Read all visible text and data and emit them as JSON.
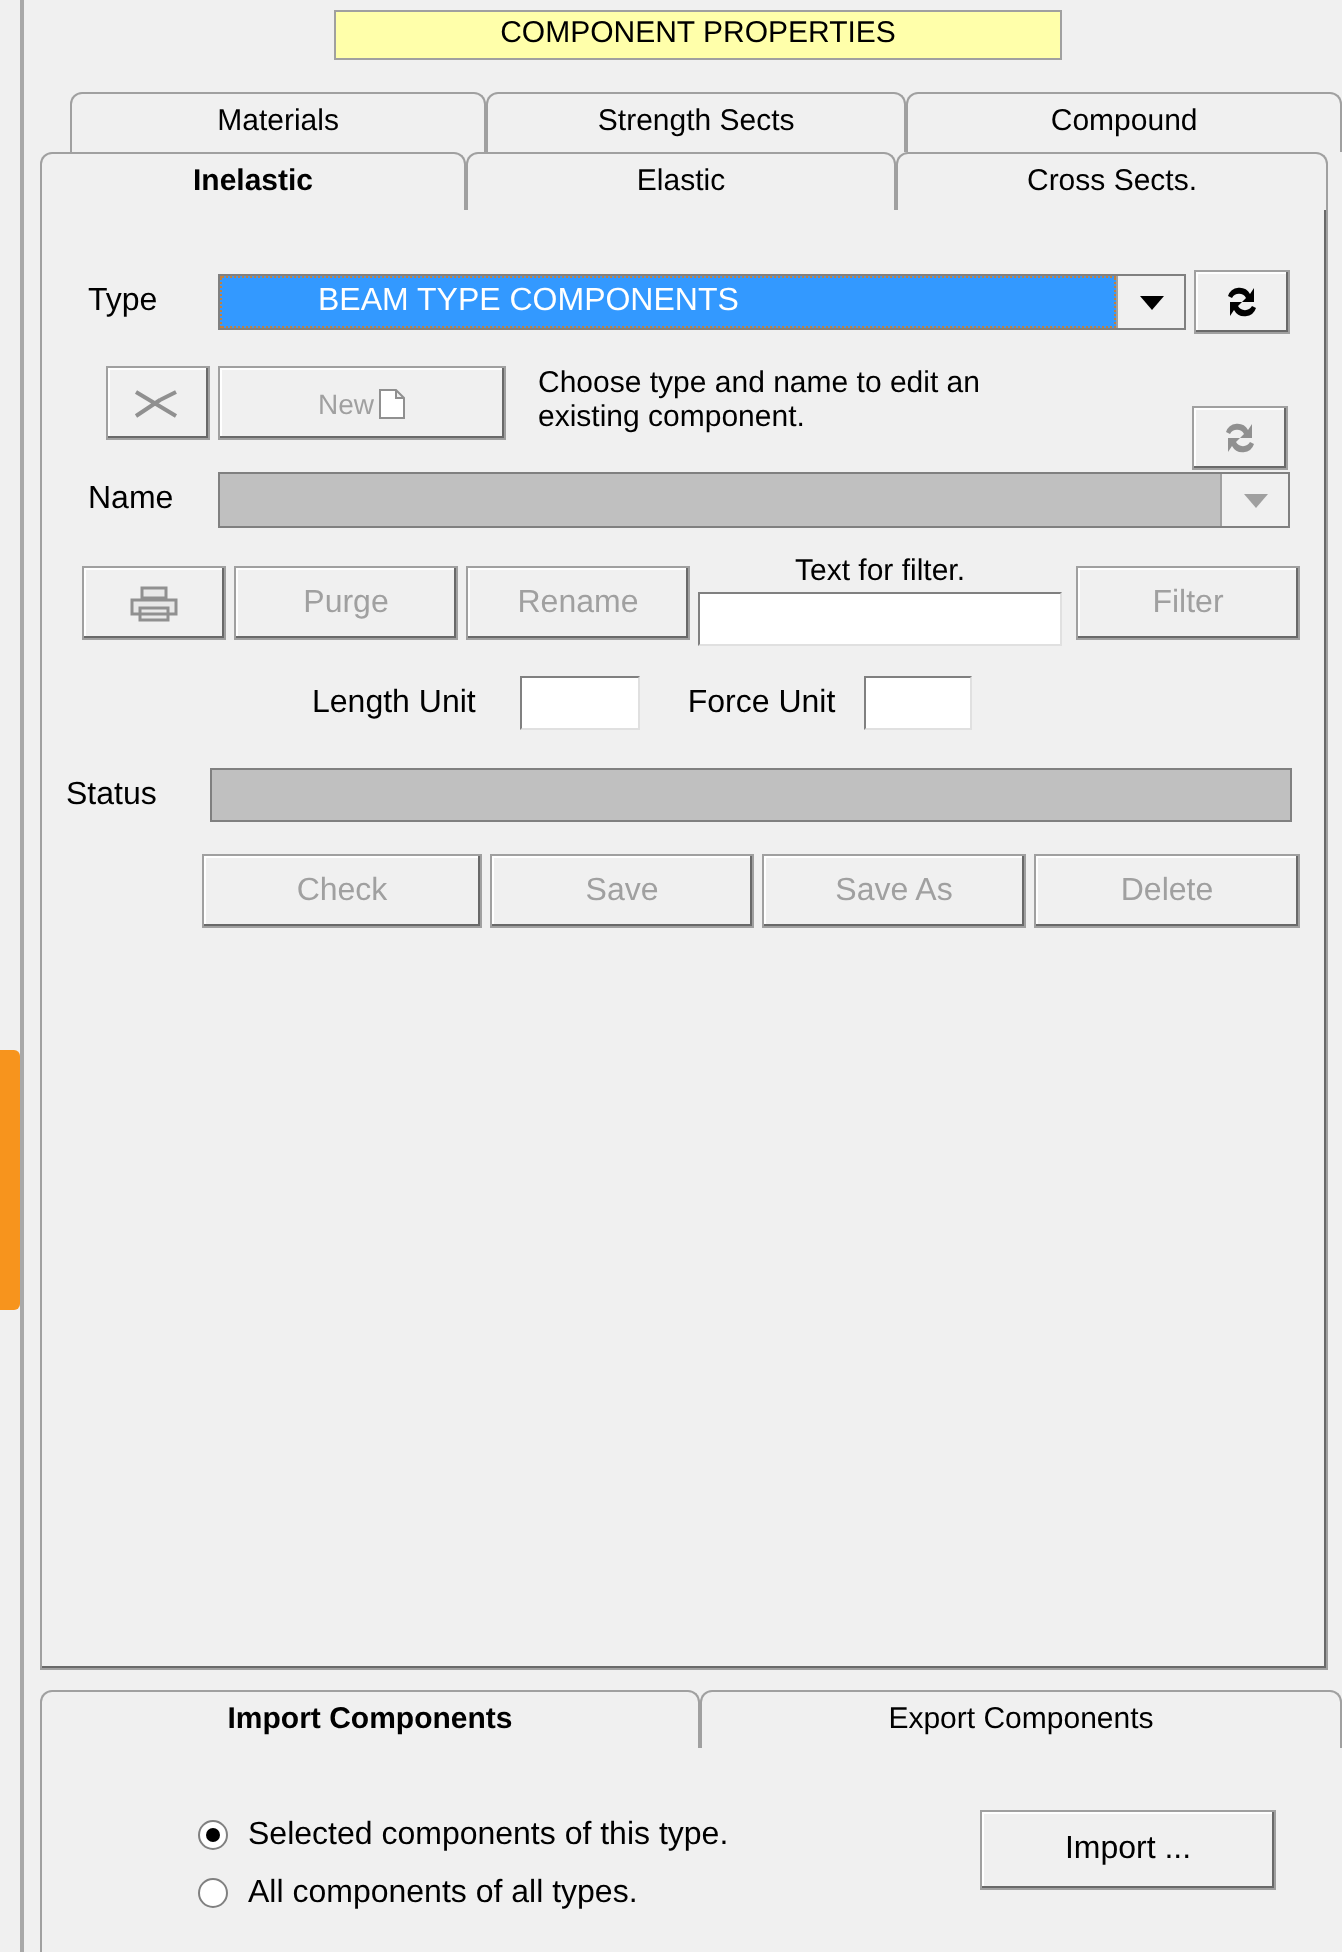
{
  "title": "COMPONENT PROPERTIES",
  "tabs_back": [
    {
      "label": "Materials",
      "selected": false
    },
    {
      "label": "Strength Sects",
      "selected": false
    },
    {
      "label": "Compound",
      "selected": false
    }
  ],
  "tabs_front": [
    {
      "label": "Inelastic",
      "selected": true
    },
    {
      "label": "Elastic",
      "selected": false
    },
    {
      "label": "Cross Sects.",
      "selected": false
    }
  ],
  "type": {
    "label": "Type",
    "value": "BEAM TYPE COMPONENTS"
  },
  "new_button": {
    "label": "New",
    "disabled": true
  },
  "hint": "Choose type and name to edit an existing component.",
  "name": {
    "label": "Name",
    "disabled": true
  },
  "manage_buttons": [
    {
      "label": "Purge",
      "disabled": true
    },
    {
      "label": "Rename",
      "disabled": true
    }
  ],
  "filter": {
    "label": "Text for filter.",
    "button": "Filter",
    "disabled": true
  },
  "units": {
    "length_label": "Length Unit",
    "force_label": "Force Unit"
  },
  "status": {
    "label": "Status"
  },
  "action_buttons": [
    {
      "label": "Check",
      "disabled": true
    },
    {
      "label": "Save",
      "disabled": true
    },
    {
      "label": "Save As",
      "disabled": true
    },
    {
      "label": "Delete",
      "disabled": true
    }
  ],
  "bottom_tabs": [
    {
      "label": "Import Components",
      "selected": true
    },
    {
      "label": "Export Components",
      "selected": false
    }
  ],
  "radios": [
    {
      "label": "Selected components of this type.",
      "selected": true
    },
    {
      "label": "All components of all types.",
      "selected": false
    }
  ],
  "import_button": {
    "label": "Import ...",
    "disabled": false
  }
}
